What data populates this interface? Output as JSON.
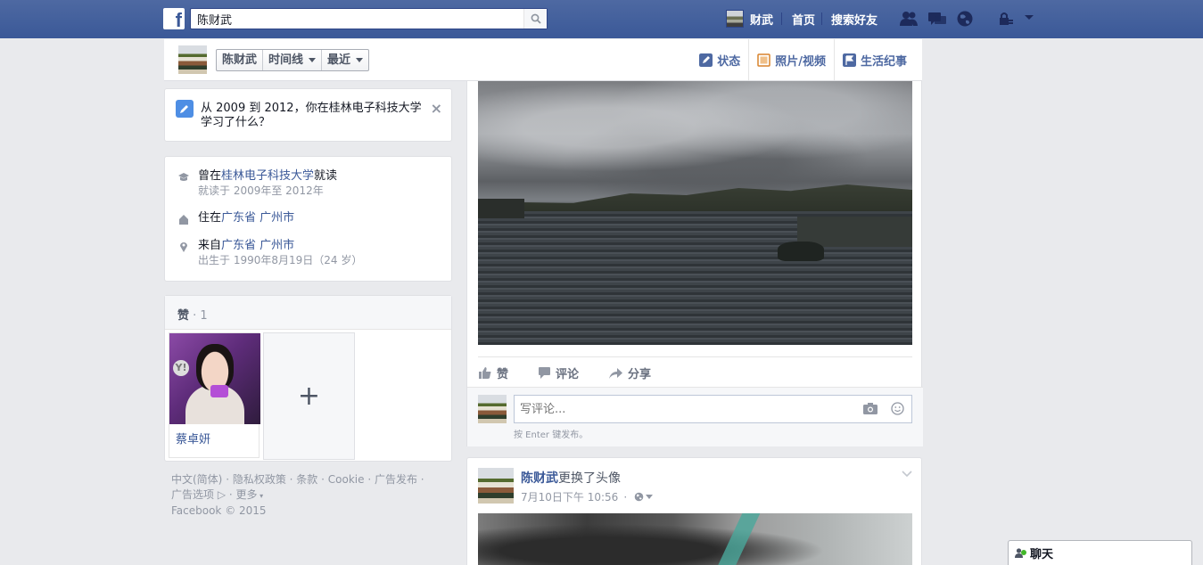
{
  "topbar": {
    "search_value": "陈财武",
    "user_name": "财武",
    "home_label": "首页",
    "find_friends_label": "搜索好友"
  },
  "timeline_header": {
    "name_button": "陈财武",
    "timeline_button": "时间线",
    "recent_button": "最近",
    "actions": {
      "status": "状态",
      "photo_video": "照片/视频",
      "life_event": "生活纪事"
    }
  },
  "question_card": {
    "text": "从 2009 到 2012，你在桂林电子科技大学学习了什么？",
    "close": "×"
  },
  "about": {
    "edu_prefix": "曾在",
    "edu_link": "桂林电子科技大学",
    "edu_suffix": "就读",
    "edu_sub": "就读于 2009年至 2012年",
    "lives_prefix": "住在",
    "lives_link": "广东省 广州市",
    "from_prefix": "来自",
    "from_link": "广东省 广州市",
    "birth_sub": "出生于 1990年8月19日（24 岁）"
  },
  "likes": {
    "title": "赞",
    "count": " · 1",
    "items": [
      {
        "name": "蔡卓妍"
      }
    ],
    "add": "+"
  },
  "footer": {
    "links": [
      "中文(简体)",
      "隐私权政策",
      "条款",
      "Cookie",
      "广告发布",
      "广告选项",
      "更多"
    ],
    "copyright": "Facebook © 2015"
  },
  "post1": {
    "actions": {
      "like": "赞",
      "comment": "评论",
      "share": "分享"
    },
    "comment_placeholder": "写评论...",
    "comment_hint": "按 Enter 键发布。"
  },
  "post2": {
    "author": "陈财武",
    "action": "更换了头像",
    "time": "7月10日下午 10:56",
    "separator": "·"
  },
  "chat": {
    "label": "聊天"
  },
  "colors": {
    "topbar": "#3b5998",
    "link": "#3b5998",
    "page_bg": "#e9eaed",
    "online": "#42b72a"
  }
}
